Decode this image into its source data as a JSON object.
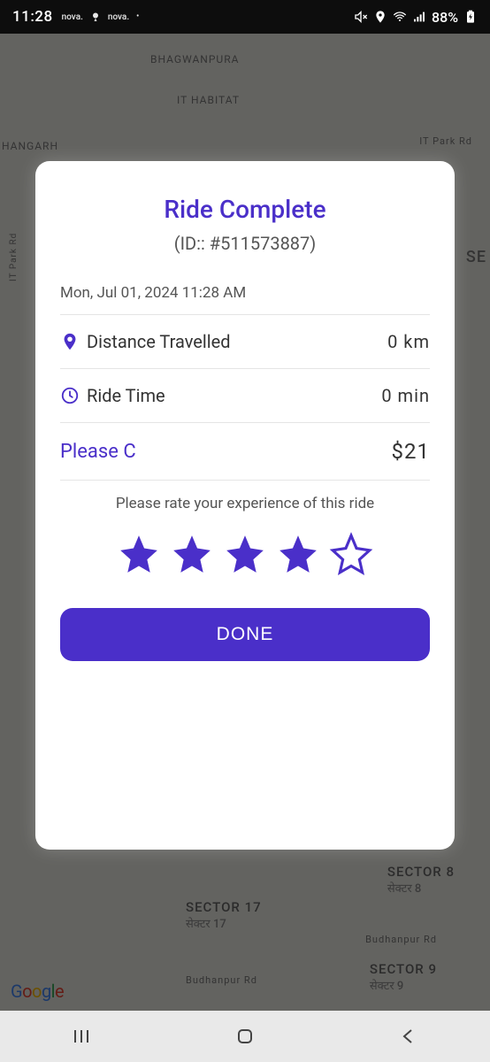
{
  "status": {
    "time": "11:28",
    "notif1": "nova.",
    "notif2": "nova.",
    "battery": "88%"
  },
  "map": {
    "bhagwanpura": "BHAGWANPURA",
    "it_habitat": "IT HABITAT",
    "hangarh": "HANGARH",
    "it_park_rd": "IT Park Rd",
    "se": "SE",
    "sector17": "SECTOR 17",
    "sector17_sub": "सेक्टर 17",
    "sector8": "SECTOR 8",
    "sector8_sub": "सेक्टर 8",
    "sector9": "SECTOR 9",
    "sector9_sub": "सेक्टर 9",
    "road1": "Budhanpur Rd",
    "road2": "Budhanpur Rd"
  },
  "modal": {
    "title": "Ride Complete",
    "id_text": "(ID:: #511573887)",
    "datetime": "Mon, Jul 01, 2024 11:28 AM",
    "distance_label": "Distance Travelled",
    "distance_value": "0 km",
    "time_label": "Ride Time",
    "time_value": "0 min",
    "price_label": "Please C",
    "price_value": "$21",
    "rate_prompt": "Please rate your experience of this ride",
    "done": "DONE",
    "rating": 4
  }
}
